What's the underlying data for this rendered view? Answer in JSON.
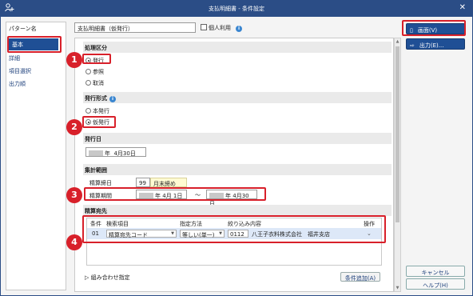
{
  "window": {
    "title": "支払明細書 - 条件設定",
    "app_icon": "person-search-icon",
    "close_icon": "close-icon"
  },
  "sidebar": {
    "header": "パターン名",
    "items": [
      {
        "label": "基本"
      },
      {
        "label": "詳細"
      },
      {
        "label": "項目選択"
      },
      {
        "label": "出力順"
      }
    ],
    "active": "基本"
  },
  "pattern": {
    "name_value": "支払明細書（仮発行）",
    "personal_label": "個人利用",
    "personal_checked": false
  },
  "sections": {
    "processing": {
      "title": "処理区分",
      "options": [
        "発行",
        "参照",
        "取消"
      ],
      "selected": "発行"
    },
    "issue_type": {
      "title": "発行形式",
      "options": [
        "本発行",
        "仮発行"
      ],
      "selected": "仮発行"
    },
    "issue_date": {
      "title": "発行日",
      "year_suffix": "年",
      "month_day": "4月30日"
    },
    "aggregation": {
      "title": "集計範囲",
      "closing_day_label": "精算締日",
      "closing_day_value": "99",
      "closing_day_text": "月末締め",
      "period_label": "精算期間",
      "from_year_suffix": "年",
      "from_month_day": "4月 1日",
      "tilde": "～",
      "to_year_suffix": "年",
      "to_month_day": "4月30日"
    },
    "destination": {
      "title": "精算宛先",
      "columns": [
        "条件",
        "検索項目",
        "指定方法",
        "絞り込み内容",
        "操作"
      ],
      "rows": [
        {
          "cond": "01",
          "item": "精算宛先コード",
          "method": "等しい(単一)",
          "code": "0112",
          "name": "八王子衣料株式会社　福井支店"
        }
      ],
      "combo_label": "組み合わせ指定",
      "add_condition_label": "条件追加(A)"
    }
  },
  "buttons": {
    "screen": "画面(V)",
    "output": "出力(E)...",
    "cancel": "キャンセル",
    "help": "ヘルプ(H)"
  },
  "callouts": [
    "1",
    "2",
    "3",
    "4"
  ],
  "colors": {
    "title_bar": "#2b4d86",
    "accent": "#1f4f95",
    "callout": "#d8202a",
    "row_highlight": "#dde8f8"
  }
}
